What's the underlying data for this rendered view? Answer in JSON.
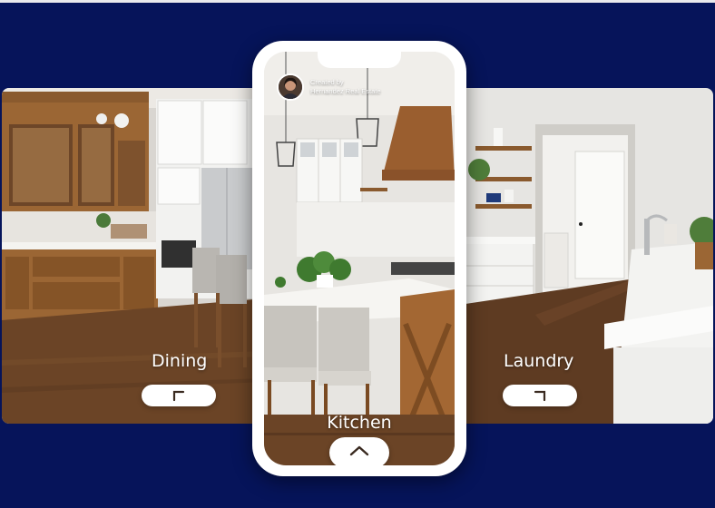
{
  "scene": {
    "creator": {
      "line1": "Created by",
      "line2": "Hernandez Real Estate"
    },
    "rooms": {
      "left": "Dining",
      "center": "Kitchen",
      "right": "Laundry"
    },
    "icons": {
      "left_nav": "arrow-up-left-icon",
      "right_nav": "arrow-up-right-icon",
      "center_nav": "chevron-up-icon"
    }
  },
  "colors": {
    "background": "#06145a",
    "phone_frame": "#ffffff",
    "label_text": "#ffffff",
    "wood": "#8a5a2e",
    "floor": "#6b4426"
  }
}
